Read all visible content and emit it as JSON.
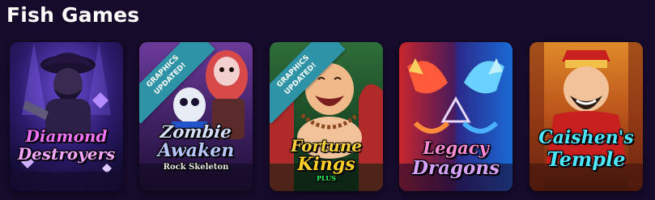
{
  "section": {
    "title": "Fish Games"
  },
  "games": [
    {
      "title_line1": "Diamond",
      "title_line2": "Destroyers",
      "accent": "#8a3dff"
    },
    {
      "ribbon_line1": "GRAPHICS",
      "ribbon_line2": "UPDATED!",
      "title_line1": "Zombie",
      "title_line2": "Awaken",
      "subtitle": "Rock Skeleton",
      "accent": "#7a3bb0"
    },
    {
      "ribbon_line1": "GRAPHICS",
      "ribbon_line2": "UPDATED!",
      "title_line1": "Fortune",
      "title_line2": "Kings",
      "subtitle": "PLUS",
      "accent": "#2c8c32"
    },
    {
      "title_line1": "Legacy",
      "title_line2": "Dragons",
      "accent": "#c83aa8"
    },
    {
      "title_line1": "Caishen's",
      "title_line2": "Temple",
      "accent": "#d2721c"
    }
  ],
  "ribbon_color": "#2f93a8"
}
